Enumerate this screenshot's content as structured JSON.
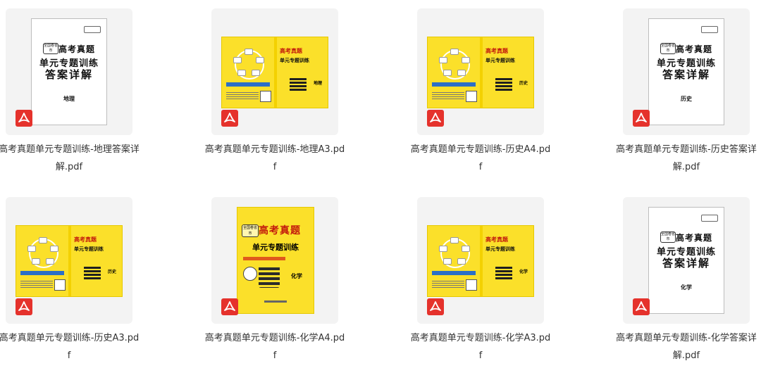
{
  "files": [
    {
      "name": "高考真题单元专题训练-地理答案详解.pdf",
      "type": "pdf",
      "cover": "white",
      "subject": "地理"
    },
    {
      "name": "高考真题单元专题训练-地理A3.pdf",
      "type": "pdf",
      "cover": "spread",
      "subject": "地理"
    },
    {
      "name": "高考真题单元专题训练-历史A4.pdf",
      "type": "pdf",
      "cover": "spread",
      "subject": "历史"
    },
    {
      "name": "高考真题单元专题训练-历史答案详解.pdf",
      "type": "pdf",
      "cover": "white",
      "subject": "历史"
    },
    {
      "name": "高考真题单元专题训练-历史A3.pdf",
      "type": "pdf",
      "cover": "spread",
      "subject": "历史"
    },
    {
      "name": "高考真题单元专题训练-化学A4.pdf",
      "type": "pdf",
      "cover": "a4",
      "subject": "化学"
    },
    {
      "name": "高考真题单元专题训练-化学A3.pdf",
      "type": "pdf",
      "cover": "spread",
      "subject": "化学"
    },
    {
      "name": "高考真题单元专题训练-化学答案详解.pdf",
      "type": "pdf",
      "cover": "white",
      "subject": "化学"
    }
  ],
  "cover_text": {
    "tag": "全国卷省市",
    "title_top": "高考真题",
    "title_mid": "单元专题训练",
    "title_answer": "答案详解"
  },
  "colors": {
    "pdf_badge": "#e5322c",
    "cover_yellow": "#fbe02a",
    "title_red": "#c2180c",
    "tile_bg": "#f3f3f3"
  },
  "icons": {
    "file_type": "pdf-icon"
  }
}
